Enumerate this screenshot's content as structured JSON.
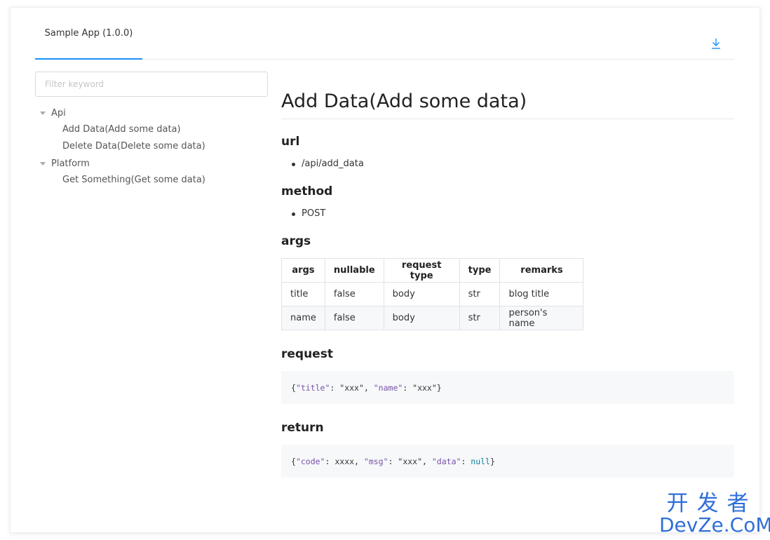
{
  "header": {
    "tab_label": "Sample App (1.0.0)",
    "download_icon": "download-icon"
  },
  "sidebar": {
    "filter_placeholder": "Filter keyword",
    "groups": [
      {
        "label": "Api",
        "items": [
          "Add Data(Add some data)",
          "Delete Data(Delete some data)"
        ]
      },
      {
        "label": "Platform",
        "items": [
          "Get Something(Get some data)"
        ]
      }
    ]
  },
  "doc": {
    "title": "Add Data(Add some data)",
    "url_heading": "url",
    "url_value": "/api/add_data",
    "method_heading": "method",
    "method_value": "POST",
    "args_heading": "args",
    "args_table": {
      "headers": [
        "args",
        "nullable",
        "request type",
        "type",
        "remarks"
      ],
      "rows": [
        [
          "title",
          "false",
          "body",
          "str",
          "blog title"
        ],
        [
          "name",
          "false",
          "body",
          "str",
          "person's name"
        ]
      ]
    },
    "request_heading": "request",
    "request_code": {
      "open": "{",
      "k1": "\"title\"",
      "s1": ": ",
      "v1": "\"xxx\"",
      "sep1": ", ",
      "k2": "\"name\"",
      "s2": ": ",
      "v2": "\"xxx\"",
      "close": "}"
    },
    "return_heading": "return",
    "return_code": {
      "open": "{",
      "k1": "\"code\"",
      "s1": ": ",
      "v1": "xxxx",
      "sep1": ", ",
      "k2": "\"msg\"",
      "s2": ": ",
      "v2": "\"xxx\"",
      "sep2": ", ",
      "k3": "\"data\"",
      "s3": ": ",
      "v3": "null",
      "close": "}"
    }
  },
  "watermark": {
    "line1": "开发者",
    "line2": "DevZe.CoM"
  },
  "colors": {
    "accent": "#1890ff",
    "code_key": "#7a52a8",
    "code_keyword": "#0e7c9c",
    "watermark": "#2f6fd8"
  }
}
